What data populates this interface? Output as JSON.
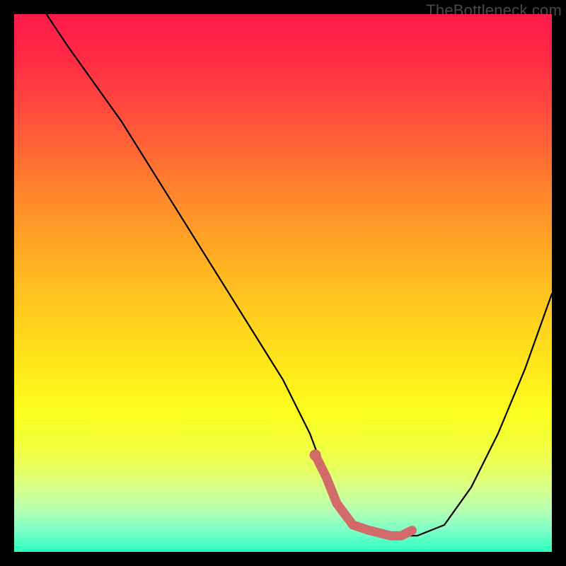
{
  "watermark": "TheBottleneck.com",
  "chart_data": {
    "type": "line",
    "title": "",
    "xlabel": "",
    "ylabel": "",
    "xlim": [
      0,
      100
    ],
    "ylim": [
      0,
      100
    ],
    "series": [
      {
        "name": "bottleneck-curve",
        "x": [
          6,
          10,
          15,
          20,
          25,
          30,
          35,
          40,
          45,
          50,
          55,
          58,
          60,
          63,
          66,
          70,
          75,
          80,
          85,
          90,
          95,
          100
        ],
        "values": [
          100,
          94,
          87,
          80,
          72,
          64,
          56,
          48,
          40,
          32,
          22,
          14,
          9,
          5,
          4,
          3,
          3,
          5,
          12,
          22,
          34,
          48
        ]
      },
      {
        "name": "highlight-segment",
        "x": [
          56,
          58,
          60,
          63,
          66,
          70,
          72,
          74
        ],
        "values": [
          18,
          14,
          9,
          5,
          4,
          3,
          3,
          4
        ]
      }
    ],
    "colors": {
      "curve": "#000000",
      "highlight": "#d36a6a",
      "gradient_top": "#ff1a4a",
      "gradient_bottom": "#2bffbf"
    }
  }
}
